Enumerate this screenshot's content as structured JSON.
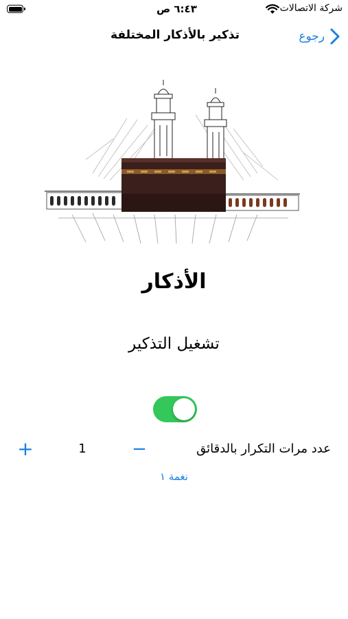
{
  "status_bar": {
    "carrier": "شركة الاتصالات",
    "time": "٦:٤٣ ص",
    "icons": [
      "wifi-icon",
      "battery-icon"
    ]
  },
  "nav": {
    "back_label": "رجوع",
    "title": "تذكير بالأذكار المختلفة"
  },
  "hero": {
    "image": "kaaba-illustration"
  },
  "content": {
    "heading": "الأذكار",
    "subheading": "تشغيل التذكير",
    "toggle_on": true
  },
  "stepper": {
    "label": "عدد مرات التكرار بالدقائق",
    "minus": "−",
    "value": "1",
    "plus": "+"
  },
  "tone": {
    "label": "نغمة ١"
  },
  "colors": {
    "accent": "#1a7fe0",
    "toggle_on": "#34c759",
    "kaaba_cloth": "#3a1f1c"
  }
}
